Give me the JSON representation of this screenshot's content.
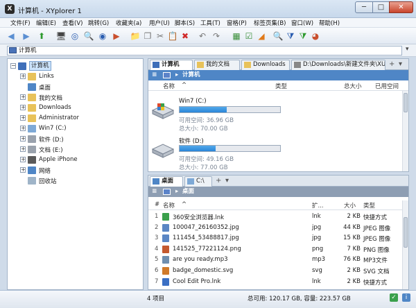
{
  "window": {
    "title": "计算机 - XYplorer 1",
    "app_icon": "X",
    "min": "─",
    "max": "□",
    "close": "✕"
  },
  "menu": [
    "文件(F)",
    "编辑(E)",
    "查看(V)",
    "跳转(G)",
    "收藏夹(a)",
    "用户(U)",
    "脚本(S)",
    "工具(T)",
    "窗格(P)",
    "标签页集(B)",
    "窗口(W)",
    "帮助(H)"
  ],
  "toolbar": {
    "icons": [
      "back-icon",
      "forward-icon",
      "up-icon",
      "computer-icon",
      "target-icon",
      "find-icon",
      "search-icon",
      "play-icon",
      "new-folder-icon",
      "copy-icon",
      "cut-icon",
      "paste-icon",
      "delete-icon",
      "undo-icon",
      "redo-icon",
      "tree-icon",
      "checkbox-icon",
      "highlight-icon",
      "find-files-icon",
      "filter-icon",
      "visual-filter-icon",
      "color-icon"
    ],
    "glyphs": [
      "◀",
      "▶",
      "⬆",
      "🖥",
      "◎",
      "🔍",
      "◉",
      "▶",
      "📁",
      "❐",
      "✂",
      "📋",
      "✖",
      "↶",
      "↷",
      "▦",
      "☑",
      "◢",
      "🔍",
      "⧩",
      "⧩",
      "◕"
    ]
  },
  "address": {
    "value": "计算机",
    "dropdown": "▾"
  },
  "tree": [
    {
      "label": "计算机",
      "level": 0,
      "toggle": "−",
      "selected": true,
      "color": "#3f6fb9"
    },
    {
      "label": "Links",
      "level": 1,
      "toggle": "+",
      "color": "#e8c25a"
    },
    {
      "label": "桌面",
      "level": 1,
      "toggle": "",
      "color": "#4f86c6"
    },
    {
      "label": "我的文档",
      "level": 1,
      "toggle": "+",
      "color": "#e8c25a"
    },
    {
      "label": "Downloads",
      "level": 1,
      "toggle": "+",
      "color": "#e8c25a"
    },
    {
      "label": "Administrator",
      "level": 1,
      "toggle": "+",
      "color": "#e8c25a"
    },
    {
      "label": "Win7 (C:)",
      "level": 1,
      "toggle": "+",
      "color": "#7ea9d6"
    },
    {
      "label": "软件 (D:)",
      "level": 1,
      "toggle": "+",
      "color": "#9aa2ad"
    },
    {
      "label": "文档 (E:)",
      "level": 1,
      "toggle": "+",
      "color": "#9aa2ad"
    },
    {
      "label": "Apple iPhone",
      "level": 1,
      "toggle": "+",
      "color": "#5a5a5a"
    },
    {
      "label": "网络",
      "level": 1,
      "toggle": "+",
      "color": "#4f86c6"
    },
    {
      "label": "回收站",
      "level": 1,
      "toggle": "",
      "color": "#9fb4c8"
    }
  ],
  "top_pane": {
    "tabs": [
      {
        "label": "计算机",
        "active": true,
        "color": "#3f6fb9"
      },
      {
        "label": "我的文档",
        "color": "#e8c25a"
      },
      {
        "label": "Downloads",
        "color": "#e8c25a"
      },
      {
        "label": "D:\\Downloads\\新建文件夹\\XU",
        "color": "#888888"
      }
    ],
    "tab_add": "+",
    "tab_menu": "▾",
    "breadcrumb": {
      "menu": "≡",
      "arrow": "▸",
      "text": "计算机",
      "bg": "#4f86c6"
    },
    "columns": [
      "名称",
      "^",
      "类型",
      "总大小",
      "已用空间"
    ],
    "drives": [
      {
        "name": "Win7 (C:)",
        "free": "可用空间: 36.96 GB",
        "total": "总大小: 70.00 GB",
        "used_fraction": 0.47,
        "kind": "system"
      },
      {
        "name": "软件 (D:)",
        "free": "可用空间: 49.16 GB",
        "total": "总大小: 77.00 GB",
        "used_fraction": 0.36,
        "kind": "disk"
      }
    ]
  },
  "bottom_pane": {
    "tabs": [
      {
        "label": "桌面",
        "active": true,
        "color": "#4f86c6"
      },
      {
        "label": "C:\\",
        "color": "#7ea9d6"
      }
    ],
    "tab_add": "+",
    "tab_menu": "▾",
    "breadcrumb": {
      "menu": "≡",
      "arrow": "▸",
      "text": "桌面",
      "bg": "#8e9eb3"
    },
    "columns": [
      "#",
      "名称",
      "^",
      "扩...",
      "大小",
      "类型"
    ],
    "files": [
      {
        "num": "1",
        "name": "360安全浏览器.lnk",
        "ext": "lnk",
        "size": "2 KB",
        "type": "快捷方式",
        "color": "#3aa04c"
      },
      {
        "num": "2",
        "name": "100047_26160352.jpg",
        "ext": "jpg",
        "size": "44 KB",
        "type": "JPEG 图像",
        "color": "#5a86c4"
      },
      {
        "num": "3",
        "name": "111454_53488817.jpg",
        "ext": "jpg",
        "size": "15 KB",
        "type": "JPEG 图像",
        "color": "#5a86c4"
      },
      {
        "num": "4",
        "name": "141525_77221124.png",
        "ext": "png",
        "size": "7 KB",
        "type": "PNG 图像",
        "color": "#c4592f"
      },
      {
        "num": "5",
        "name": "are you ready.mp3",
        "ext": "mp3",
        "size": "76 KB",
        "type": "MP3文件",
        "color": "#6f8fb0"
      },
      {
        "num": "6",
        "name": "badge_domestic.svg",
        "ext": "svg",
        "size": "2 KB",
        "type": "SVG 文档",
        "color": "#d07a2a"
      },
      {
        "num": "7",
        "name": "Cool Edit Pro.lnk",
        "ext": "lnk",
        "size": "2 KB",
        "type": "快捷方式",
        "color": "#3a6fc4"
      }
    ]
  },
  "status": {
    "items": "4 项目",
    "space": "总可用: 120.17 GB, 容量: 223.57 GB"
  }
}
